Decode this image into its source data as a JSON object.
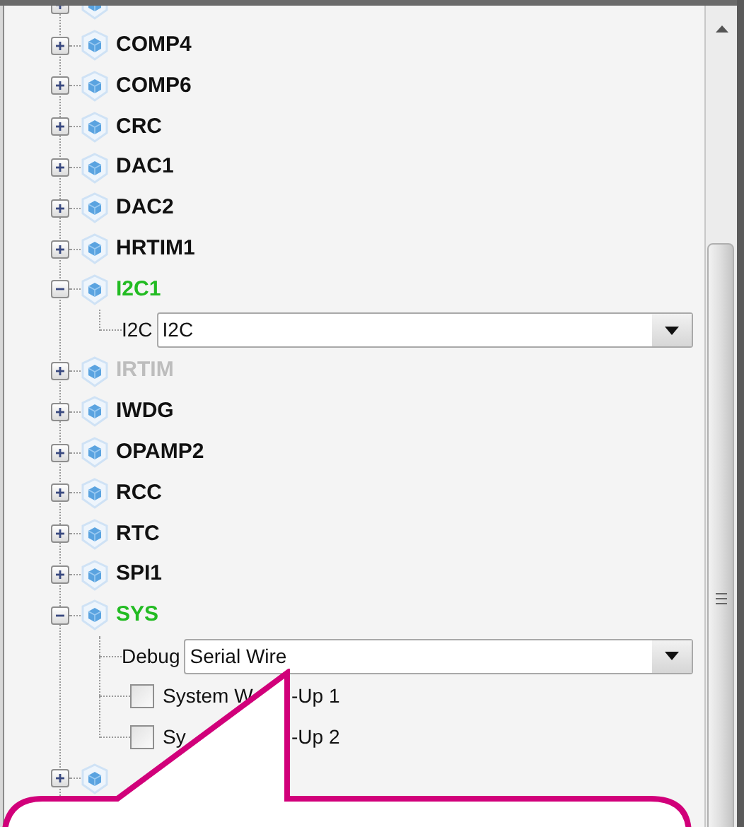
{
  "tree": {
    "items": [
      {
        "expanded": false
      },
      {
        "label": "COMP4",
        "expanded": false,
        "configured": false,
        "disabled": false
      },
      {
        "label": "COMP6",
        "expanded": false,
        "configured": false,
        "disabled": false
      },
      {
        "label": "CRC",
        "expanded": false,
        "configured": false,
        "disabled": false
      },
      {
        "label": "DAC1",
        "expanded": false,
        "configured": false,
        "disabled": false
      },
      {
        "label": "DAC2",
        "expanded": false,
        "configured": false,
        "disabled": false
      },
      {
        "label": "HRTIM1",
        "expanded": false,
        "configured": false,
        "disabled": false
      },
      {
        "label": "I2C1",
        "expanded": true,
        "configured": true,
        "disabled": false,
        "children": [
          {
            "kind": "combo",
            "label": "I2C",
            "value": "I2C"
          }
        ]
      },
      {
        "label": "IRTIM",
        "expanded": false,
        "configured": false,
        "disabled": true
      },
      {
        "label": "IWDG",
        "expanded": false,
        "configured": false,
        "disabled": false
      },
      {
        "label": "OPAMP2",
        "expanded": false,
        "configured": false,
        "disabled": false
      },
      {
        "label": "RCC",
        "expanded": false,
        "configured": false,
        "disabled": false
      },
      {
        "label": "RTC",
        "expanded": false,
        "configured": false,
        "disabled": false
      },
      {
        "label": "SPI1",
        "expanded": false,
        "configured": false,
        "disabled": false
      },
      {
        "label": "SYS",
        "expanded": true,
        "configured": true,
        "disabled": false,
        "children": [
          {
            "kind": "combo",
            "label": "Debug",
            "value": "Serial Wire"
          },
          {
            "kind": "checkbox",
            "label_parts": [
              "System W",
              "-Up 1"
            ],
            "checked": false
          },
          {
            "kind": "checkbox",
            "label_parts": [
              "Sy",
              "-Up 2"
            ],
            "checked": false
          }
        ]
      },
      {
        "expanded": false
      }
    ]
  }
}
